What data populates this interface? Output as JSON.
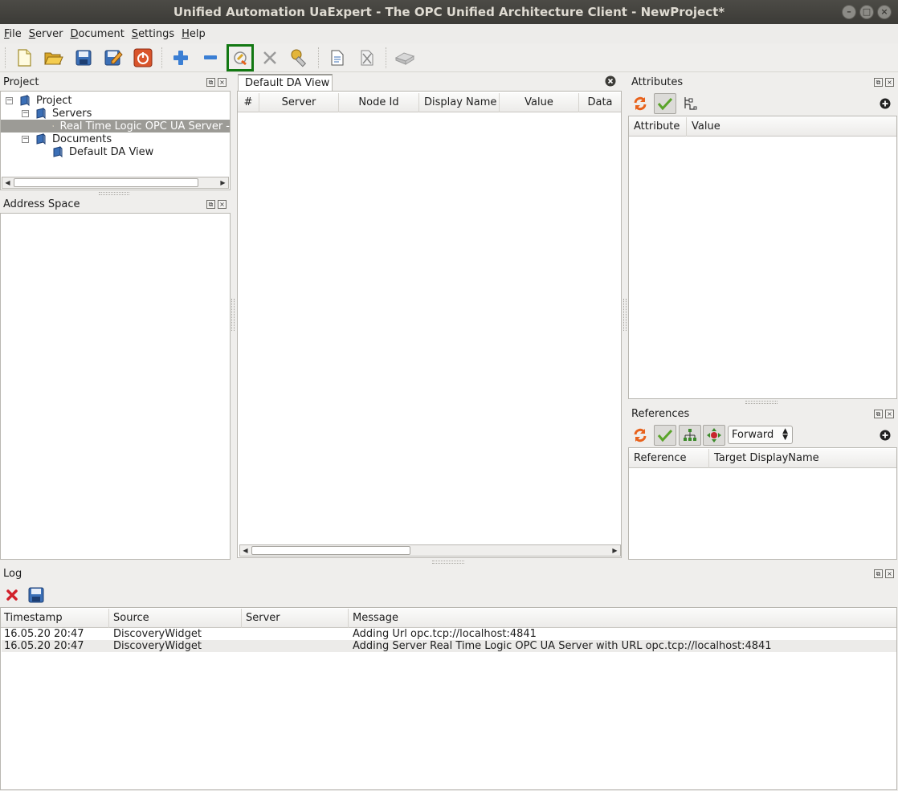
{
  "window": {
    "title": "Unified Automation UaExpert - The OPC Unified Architecture Client - NewProject*"
  },
  "menu": [
    {
      "mnemonic": "F",
      "rest": "ile"
    },
    {
      "mnemonic": "S",
      "rest": "erver"
    },
    {
      "mnemonic": "D",
      "rest": "ocument"
    },
    {
      "mnemonic": "S",
      "rest": "ettings"
    },
    {
      "mnemonic": "H",
      "rest": "elp"
    }
  ],
  "toolbar": {
    "icons": [
      "new-project-icon",
      "open-project-icon",
      "save-project-icon",
      "save-as-icon",
      "disconnect-all-icon",
      "add-server-icon",
      "remove-server-icon",
      "connect-server-icon",
      "disconnect-server-icon",
      "server-settings-icon",
      "add-document-icon",
      "remove-document-icon",
      "plugin-icon"
    ],
    "highlight_color": "#127812"
  },
  "project": {
    "title": "Project",
    "tree": {
      "root": "Project",
      "servers": "Servers",
      "server_item": "Real Time Logic OPC UA Server -",
      "documents": "Documents",
      "document_item": "Default DA View"
    }
  },
  "address_space": {
    "title": "Address Space"
  },
  "da_view": {
    "tab": "Default DA View",
    "columns": [
      "#",
      "Server",
      "Node Id",
      "Display Name",
      "Value",
      "Data"
    ]
  },
  "attributes": {
    "title": "Attributes",
    "columns": [
      "Attribute",
      "Value"
    ]
  },
  "references": {
    "title": "References",
    "direction": "Forward",
    "columns": [
      "Reference",
      "Target DisplayName"
    ]
  },
  "log": {
    "title": "Log",
    "columns": [
      "Timestamp",
      "Source",
      "Server",
      "Message"
    ],
    "rows": [
      {
        "timestamp": "16.05.20 20:47",
        "source": "DiscoveryWidget",
        "server": "",
        "message": "Adding Url opc.tcp://localhost:4841"
      },
      {
        "timestamp": "16.05.20 20:47",
        "source": "DiscoveryWidget",
        "server": "",
        "message": "Adding Server Real Time Logic OPC UA Server with URL opc.tcp://localhost:4841"
      }
    ]
  },
  "colors": {
    "accent_orange": "#e8621c",
    "selection": "#9c9b96"
  }
}
